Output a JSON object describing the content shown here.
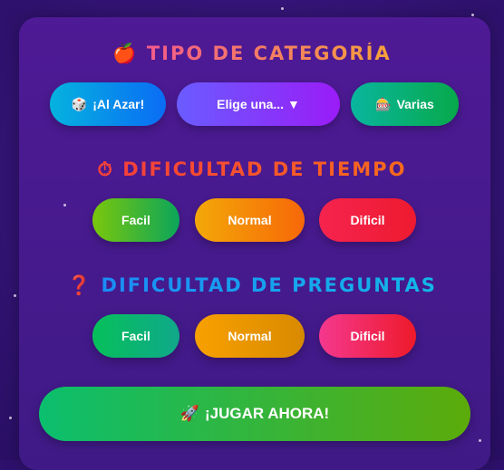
{
  "categoria": {
    "title": "TIPO DE CATEGORÍA",
    "icon": "🍎",
    "random": "¡Al Azar!",
    "random_icon": "🎲",
    "select": "Elige una... ▼",
    "multi": "Varias",
    "multi_icon": "🎰"
  },
  "tiempo": {
    "title": "DIFICULTAD DE TIEMPO",
    "icon": "⏱",
    "easy": "Facil",
    "normal": "Normal",
    "hard": "Dificil"
  },
  "preguntas": {
    "title": "DIFICULTAD DE PREGUNTAS",
    "icon": "❓",
    "easy": "Facil",
    "normal": "Normal",
    "hard": "Dificil"
  },
  "play": {
    "label": "¡JUGAR AHORA!",
    "icon": "🚀"
  }
}
